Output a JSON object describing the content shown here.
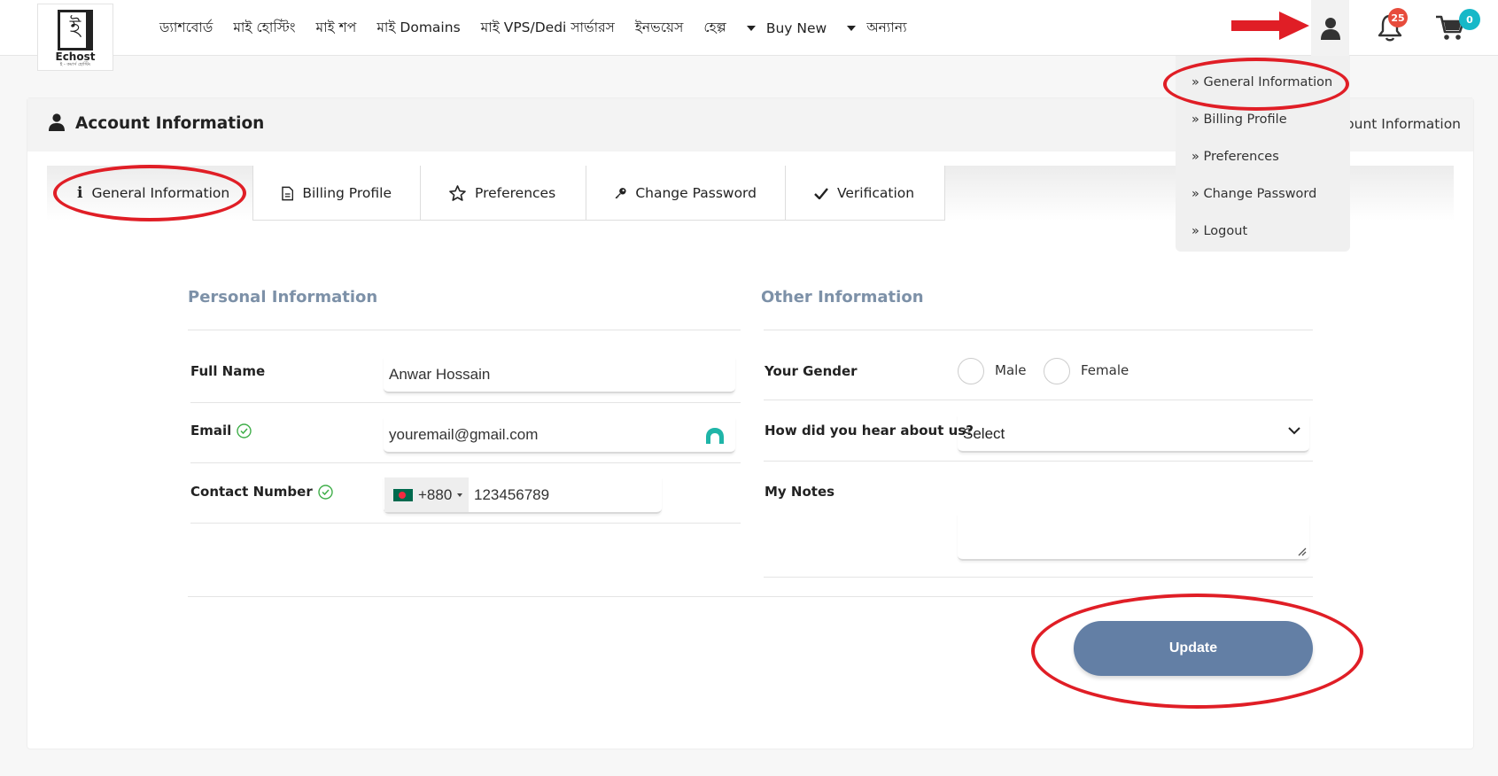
{
  "brand": {
    "name": "Echost",
    "glyph": "ই",
    "tagline": "ই - কমার্স হোস্টিং"
  },
  "nav": [
    {
      "label": "ড্যাশবোর্ড",
      "caret": false
    },
    {
      "label": "মাই হোস্টিং",
      "caret": false
    },
    {
      "label": "মাই শপ",
      "caret": false
    },
    {
      "label": "মাই Domains",
      "caret": false
    },
    {
      "label": "মাই VPS/Dedi সার্ভারস",
      "caret": false
    },
    {
      "label": "ইনভয়েস",
      "caret": false
    },
    {
      "label": "হেল্প",
      "caret": false
    },
    {
      "label": "Buy New",
      "caret": true
    },
    {
      "label": "অন্যান্য",
      "caret": true
    }
  ],
  "header": {
    "notifications_count": "25",
    "cart_count": "0"
  },
  "user_menu": [
    "» General Information",
    "» Billing Profile",
    "» Preferences",
    "» Change Password",
    "» Logout"
  ],
  "page": {
    "title": "Account Information",
    "breadcrumb": "Account Information"
  },
  "tabs": [
    {
      "label": "General Information",
      "icon": "info-icon"
    },
    {
      "label": "Billing Profile",
      "icon": "document-icon"
    },
    {
      "label": "Preferences",
      "icon": "star-icon"
    },
    {
      "label": "Change Password",
      "icon": "key-icon"
    },
    {
      "label": "Verification",
      "icon": "check-icon"
    }
  ],
  "personal": {
    "title": "Personal Information",
    "full_name_label": "Full Name",
    "full_name_value": "Anwar Hossain",
    "email_label": "Email",
    "email_value": "youremail@gmail.com",
    "contact_label": "Contact Number",
    "country_code": "+880",
    "phone_value": "123456789"
  },
  "other": {
    "title": "Other Information",
    "gender_label": "Your Gender",
    "gender_options": [
      "Male",
      "Female"
    ],
    "hear_label": "How did you hear about us?",
    "hear_value": "Select",
    "notes_label": "My Notes"
  },
  "actions": {
    "update_label": "Update"
  },
  "colors": {
    "accent": "#637fa5",
    "section_title": "#7d91a8",
    "annotation": "#e01e26",
    "badge_red": "#e74c3c",
    "badge_teal": "#17b8c8",
    "verified": "#3fae49"
  }
}
